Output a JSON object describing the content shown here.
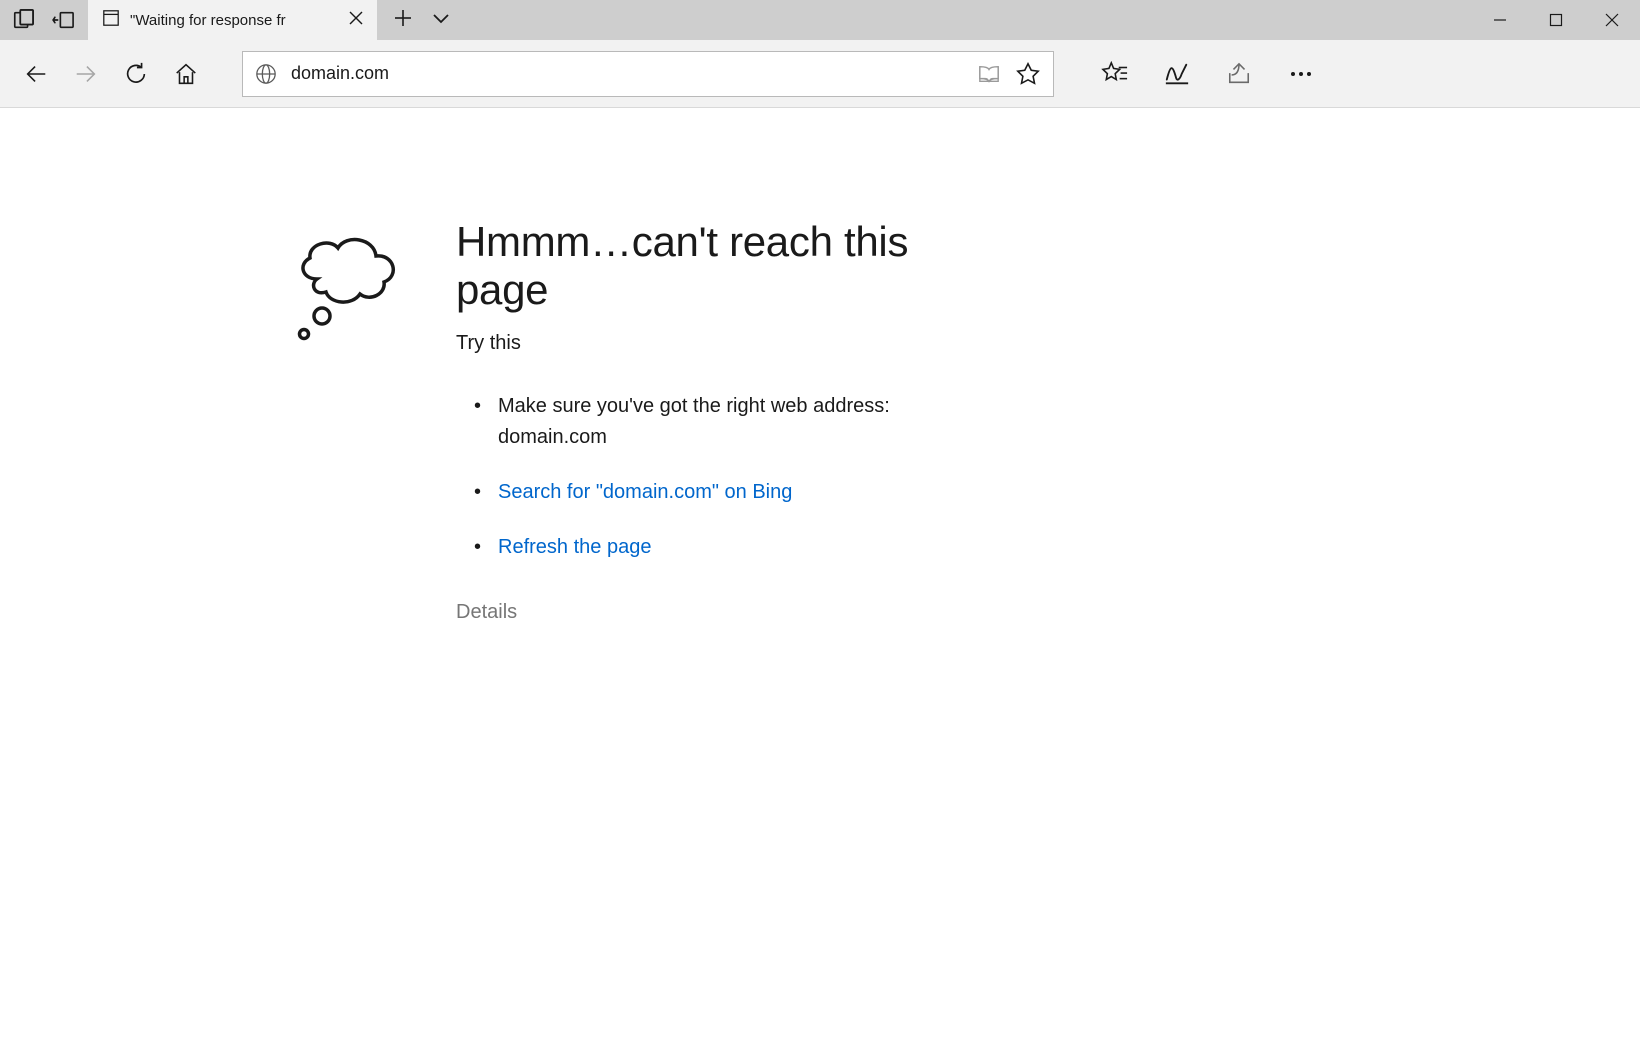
{
  "tab": {
    "title": "\"Waiting for response fr"
  },
  "address_bar": {
    "url": "domain.com"
  },
  "error": {
    "heading": "Hmmm…can't reach this page",
    "try_this": "Try this",
    "suggestions": [
      "Make sure you've got the right web address: domain.com",
      "Search for \"domain.com\" on Bing",
      "Refresh the page"
    ],
    "details_label": "Details"
  },
  "colors": {
    "link": "#0066cc",
    "muted": "#767676",
    "text": "#1a1a1a"
  }
}
